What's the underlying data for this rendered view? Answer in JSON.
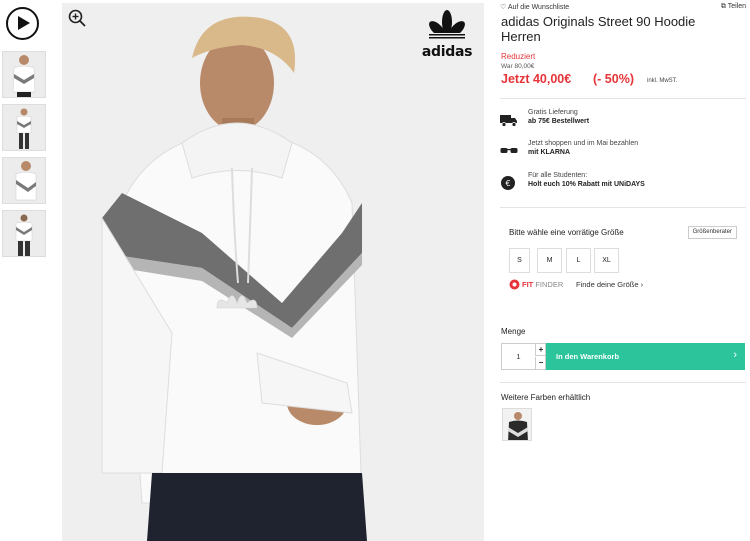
{
  "gallery": {
    "play_icon": "play-circle-icon",
    "thumbnails": [
      "thumbnail-front",
      "thumbnail-full",
      "thumbnail-side",
      "thumbnail-back"
    ],
    "zoom_icon": "zoom-in-icon"
  },
  "brand": {
    "logo_text": "adidas"
  },
  "header_links": {
    "wishlist": "Auf die Wunschliste",
    "share": "Teilen"
  },
  "product": {
    "title": "adidas Originals Street 90 Hoodie Herren",
    "reduced_label": "Reduziert",
    "was_price": "War 80,00€",
    "now_price": "Jetzt 40,00€",
    "discount": "(- 50%)",
    "vat_note": "inkl. MwST."
  },
  "features": [
    {
      "icon": "truck-icon",
      "line1": "Gratis Lieferung",
      "line2": "ab 75€ Bestellwert"
    },
    {
      "icon": "glasses-icon",
      "line1": "Jetzt shoppen und im Mai bezahlen",
      "line2": "mit KLARNA"
    },
    {
      "icon": "euro-icon",
      "line1": "Für alle Studenten:",
      "line2": "Holt euch 10% Rabatt mit UNiDAYS"
    }
  ],
  "sizes": {
    "prompt": "Bitte wähle eine vorrätige Größe",
    "guide_button": "Größenberater",
    "options": [
      "S",
      "M",
      "L",
      "XL"
    ],
    "fit_brand_a": "FIT",
    "fit_brand_b": "FINDER",
    "fit_link": "Finde deine Größe ›"
  },
  "quantity": {
    "label": "Menge",
    "value": "1",
    "plus": "+",
    "minus": "−"
  },
  "cart": {
    "label": "In den Warenkorb",
    "arrow": "›"
  },
  "other_colors": {
    "label": "Weitere Farben erhältlich"
  },
  "colors": {
    "accent": "#2bc49b",
    "sale": "#e63438"
  }
}
